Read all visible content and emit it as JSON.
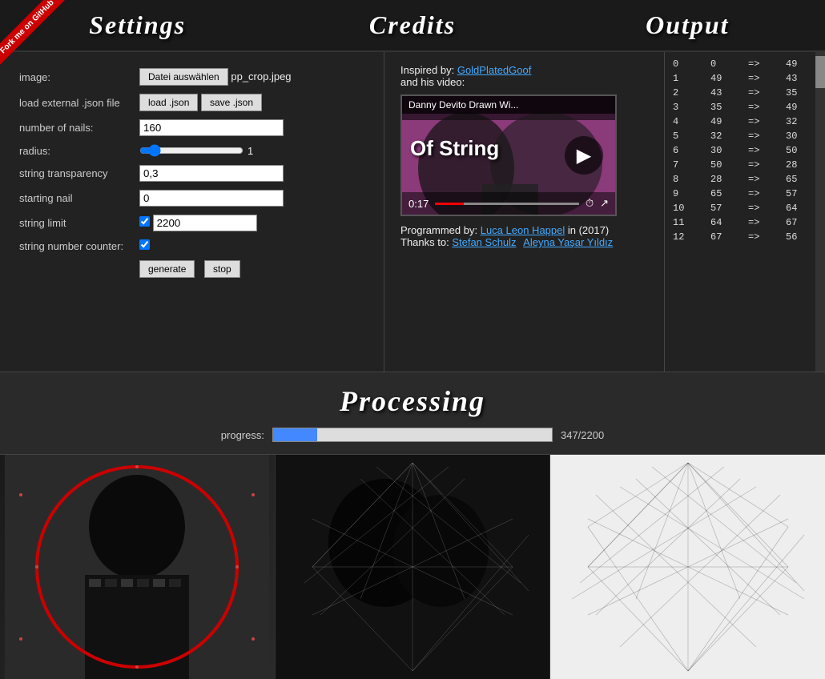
{
  "header": {
    "settings_label": "Settings",
    "credits_label": "Credits",
    "output_label": "Output"
  },
  "github": {
    "label": "Fork me on GitHub"
  },
  "settings": {
    "image_label": "image:",
    "file_button_label": "Datei auswählen",
    "file_name": "pp_crop.jpeg",
    "load_json_label": "load .json",
    "save_json_label": "save .json",
    "nails_label": "number of nails:",
    "nails_value": "160",
    "radius_label": "radius:",
    "radius_value": "1",
    "transparency_label": "string transparency",
    "transparency_value": "0,3",
    "starting_nail_label": "starting nail",
    "starting_nail_value": "0",
    "string_limit_label": "string limit",
    "string_limit_checked": true,
    "string_limit_value": "2200",
    "string_counter_label": "string number counter:",
    "string_counter_checked": true,
    "generate_label": "generate",
    "stop_label": "stop"
  },
  "credits": {
    "inspired_by": "Inspired by:",
    "inspired_link": "GoldPlatedGoof",
    "and_his_video": "and his video:",
    "video_title": "Danny Devito Drawn Wi...",
    "video_big_text_line1": "Of String",
    "video_time": "0:17",
    "programmed_by": "Programmed by:",
    "programmer_link": "Luca Leon Happel",
    "year": "in (2017)",
    "thanks_to": "Thanks to:",
    "thanks_link1": "Stefan Schulz",
    "thanks_link2": "Aleyna Yaşar Yıldız"
  },
  "output": {
    "rows": [
      {
        "index": 0,
        "from": 0,
        "to": 49
      },
      {
        "index": 1,
        "from": 49,
        "to": 43
      },
      {
        "index": 2,
        "from": 43,
        "to": 35
      },
      {
        "index": 3,
        "from": 35,
        "to": 49
      },
      {
        "index": 4,
        "from": 49,
        "to": 32
      },
      {
        "index": 5,
        "from": 32,
        "to": 30
      },
      {
        "index": 6,
        "from": 30,
        "to": 50
      },
      {
        "index": 7,
        "from": 50,
        "to": 28
      },
      {
        "index": 8,
        "from": 28,
        "to": 65
      },
      {
        "index": 9,
        "from": 65,
        "to": 57
      },
      {
        "index": 10,
        "from": 57,
        "to": 64
      },
      {
        "index": 11,
        "from": 64,
        "to": 67
      },
      {
        "index": 12,
        "from": 67,
        "to": 56
      }
    ]
  },
  "processing": {
    "title": "Processing",
    "progress_label": "progress:",
    "progress_current": 347,
    "progress_total": 2200,
    "progress_text": "347/2200",
    "progress_percent": 15.8
  }
}
